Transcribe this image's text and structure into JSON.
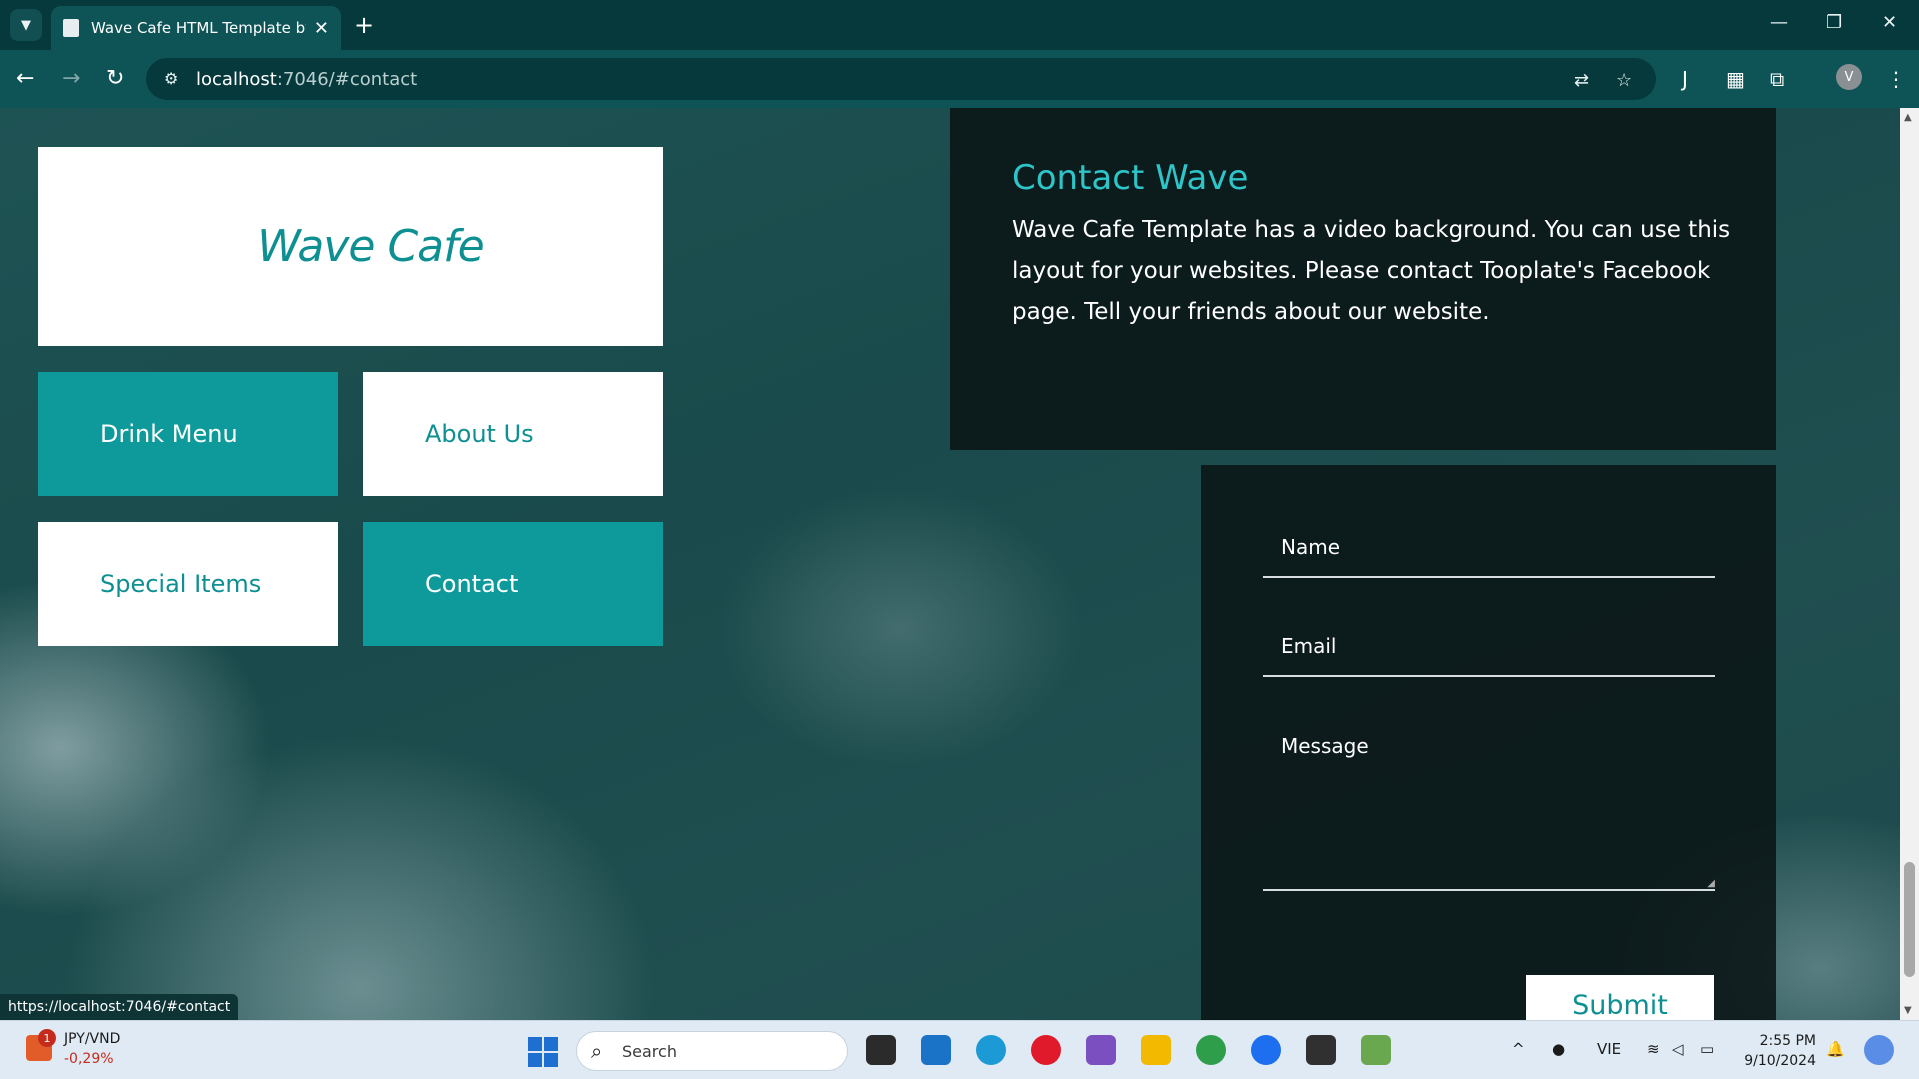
{
  "browser": {
    "tab_title": "Wave Cafe HTML Template by T",
    "url_host": "localhost",
    "url_rest": ":7046/#contact",
    "status_url": "https://localhost:7046/#contact",
    "profile_initial": "V"
  },
  "page": {
    "logo": "Wave Cafe",
    "menu": [
      {
        "label": "Drink Menu",
        "style": "teal"
      },
      {
        "label": "About Us",
        "style": "white"
      },
      {
        "label": "Special Items",
        "style": "white"
      },
      {
        "label": "Contact",
        "style": "teal"
      }
    ],
    "contact": {
      "title": "Contact Wave",
      "text": "Wave Cafe Template has a video background. You can use this layout for your websites. Please contact Tooplate's Facebook page. Tell your friends about our website."
    },
    "form": {
      "name_placeholder": "Name",
      "email_placeholder": "Email",
      "message_placeholder": "Message",
      "submit_label": "Submit"
    },
    "colors": {
      "accent": "#0e9a9a",
      "title": "#2ec5c8"
    }
  },
  "taskbar": {
    "widget_badge": "1",
    "widget_name": "JPY/VND",
    "widget_change": "-0,29%",
    "search_label": "Search",
    "language": "VIE",
    "time": "2:55 PM",
    "date": "9/10/2024"
  }
}
